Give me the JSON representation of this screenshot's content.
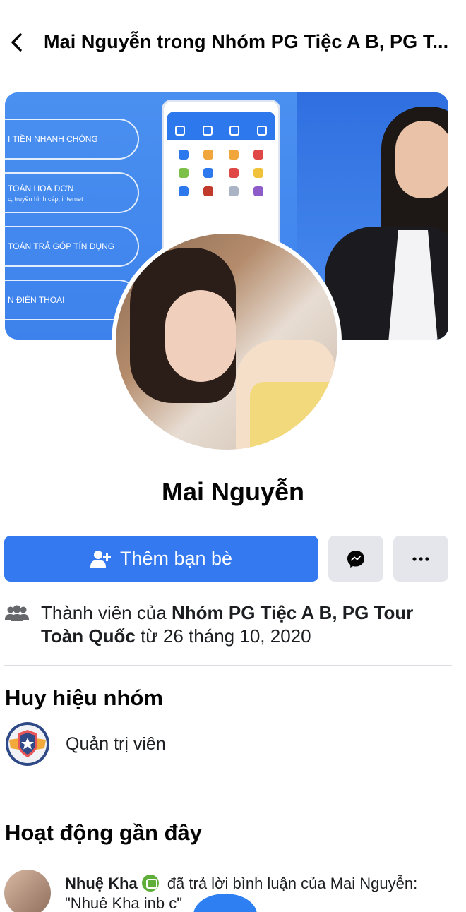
{
  "header": {
    "title": "Mai Nguyễn trong Nhóm PG Tiệc A B, PG T..."
  },
  "cover": {
    "pills": [
      {
        "label": "I TIỀN NHANH CHÓNG",
        "sub": ""
      },
      {
        "label": "TOÁN HOÁ ĐƠN",
        "sub": "c, truyền hình cáp, internet"
      },
      {
        "label": "TOÁN TRẢ GÓP TÍN DỤNG",
        "sub": ""
      },
      {
        "label": "N ĐIỆN THOẠI",
        "sub": ""
      }
    ]
  },
  "profile": {
    "name": "Mai Nguyễn"
  },
  "actions": {
    "add_friend": "Thêm bạn bè"
  },
  "membership": {
    "prefix": "Thành viên của ",
    "group": "Nhóm PG Tiệc A B, PG Tour Toàn Quốc",
    "suffix": " từ 26 tháng 10, 2020"
  },
  "badges": {
    "title": "Huy hiệu nhóm",
    "items": [
      {
        "label": "Quản trị viên"
      }
    ]
  },
  "activity": {
    "title": "Hoạt động gần đây",
    "items": [
      {
        "user": "Nhuệ Kha",
        "action": "đã trả lời bình luận của Mai Nguyễn:",
        "quote": "\"Nhuê Kha inb c\""
      }
    ]
  },
  "colors": {
    "primary": "#3479f0",
    "secondary_button": "#e4e6eb",
    "text": "#050505"
  }
}
